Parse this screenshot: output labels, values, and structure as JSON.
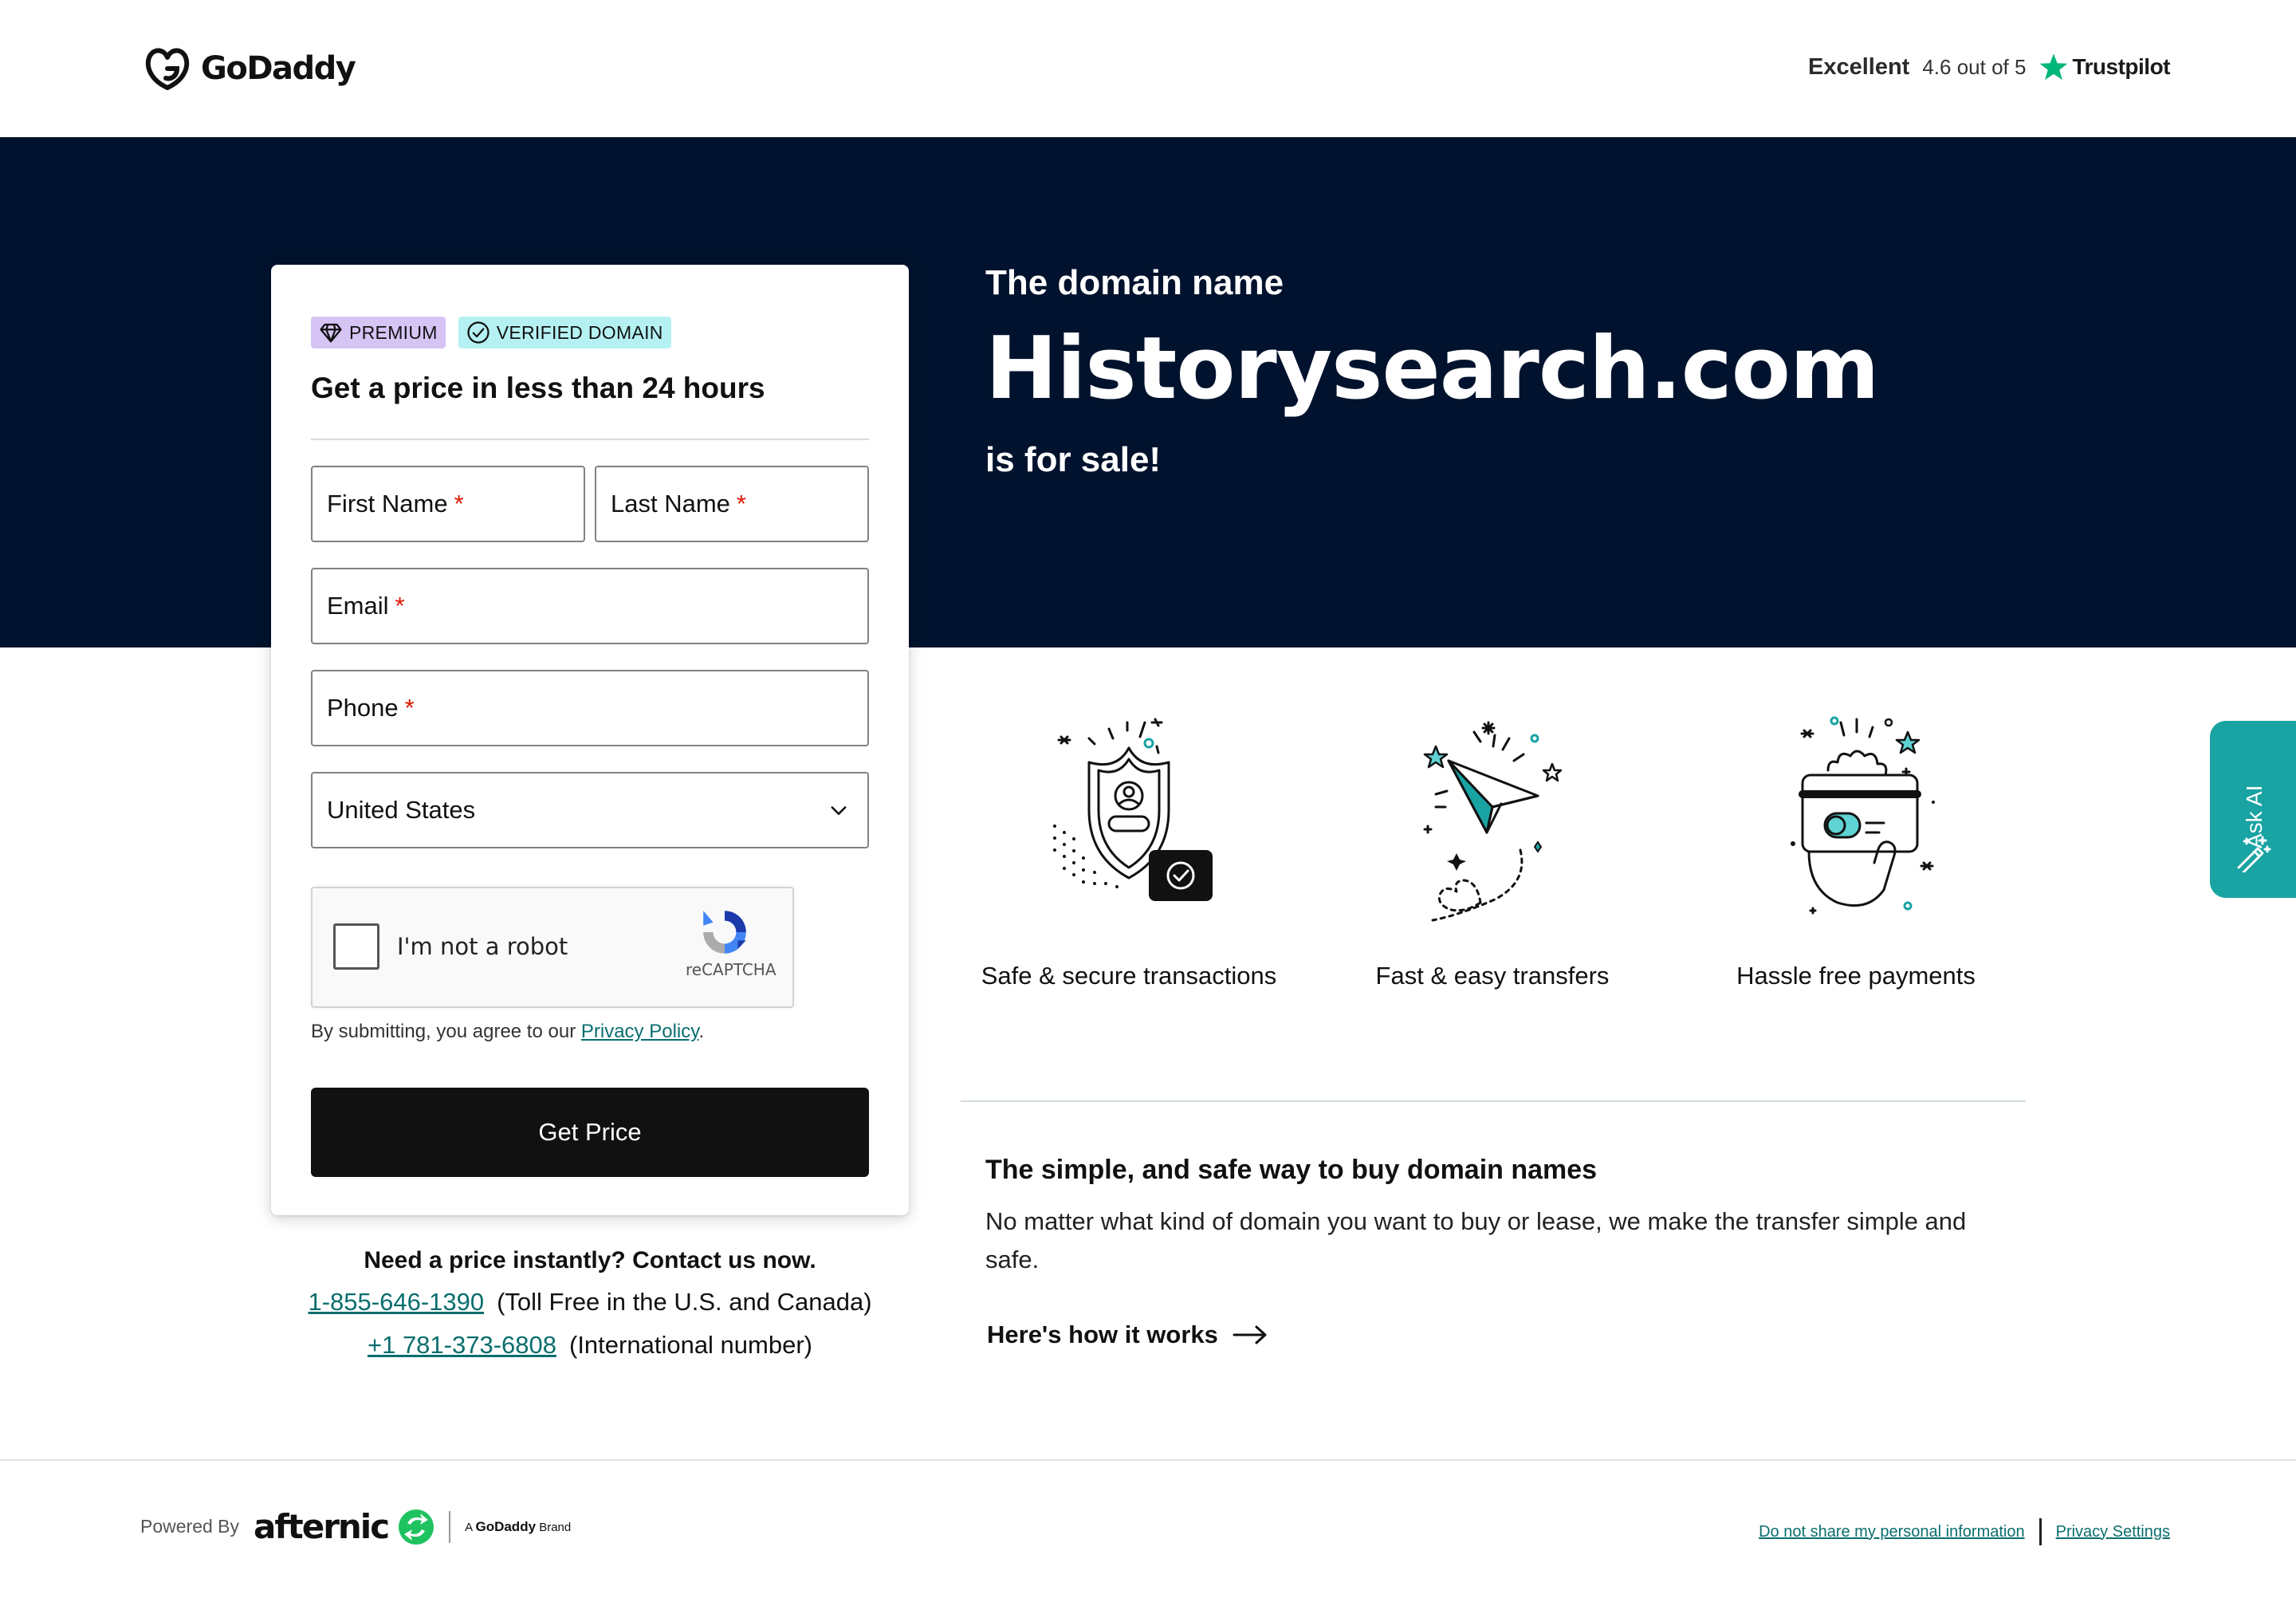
{
  "header": {
    "brand": "GoDaddy",
    "rating_label": "Excellent",
    "rating_score": "4.6 out of 5",
    "rating_brand": "Trustpilot"
  },
  "hero": {
    "pre": "The domain name",
    "domain": "Historysearch.com",
    "post": "is for sale!"
  },
  "form": {
    "badges": [
      "PREMIUM",
      "VERIFIED DOMAIN"
    ],
    "title": "Get a price in less than 24 hours",
    "fields": {
      "first_name": "First Name",
      "last_name": "Last Name",
      "email": "Email",
      "phone": "Phone",
      "required_mark": "*"
    },
    "country": "United States",
    "recaptcha": {
      "label": "I'm not a robot",
      "brand": "reCAPTCHA"
    },
    "terms_prefix": "By submitting, you agree to our ",
    "terms_link": "Privacy Policy",
    "terms_suffix": ".",
    "submit": "Get Price"
  },
  "contact": {
    "title": "Need a price instantly? Contact us now.",
    "phones": [
      {
        "number": "1-855-646-1390",
        "note": "(Toll Free in the U.S. and Canada)"
      },
      {
        "number": "+1 781-373-6808",
        "note": "(International number)"
      }
    ]
  },
  "features": [
    {
      "label": "Safe & secure transactions",
      "icon": "shield-check-icon"
    },
    {
      "label": "Fast & easy transfers",
      "icon": "paper-plane-icon"
    },
    {
      "label": "Hassle free payments",
      "icon": "hand-card-icon"
    }
  ],
  "info": {
    "title": "The simple, and safe way to buy domain names",
    "text": "No matter what kind of domain you want to buy or lease, we make the transfer simple and safe.",
    "link": "Here's how it works"
  },
  "ask_ai": {
    "label": "Ask AI"
  },
  "footer": {
    "powered_by": "Powered By",
    "afternic": "afternic",
    "brand_prefix": "A",
    "brand_name": "GoDaddy",
    "brand_suffix": "Brand",
    "links": [
      "Do not share my personal information",
      "Privacy Settings"
    ]
  },
  "colors": {
    "hero_bg": "#00122d",
    "accent_teal": "#19a3a3",
    "link": "#0a6e6e",
    "premium_badge": "#d6c4f5",
    "verified_badge": "#b5f1f2",
    "trustpilot_green": "#00b67a",
    "required": "#db1802"
  }
}
